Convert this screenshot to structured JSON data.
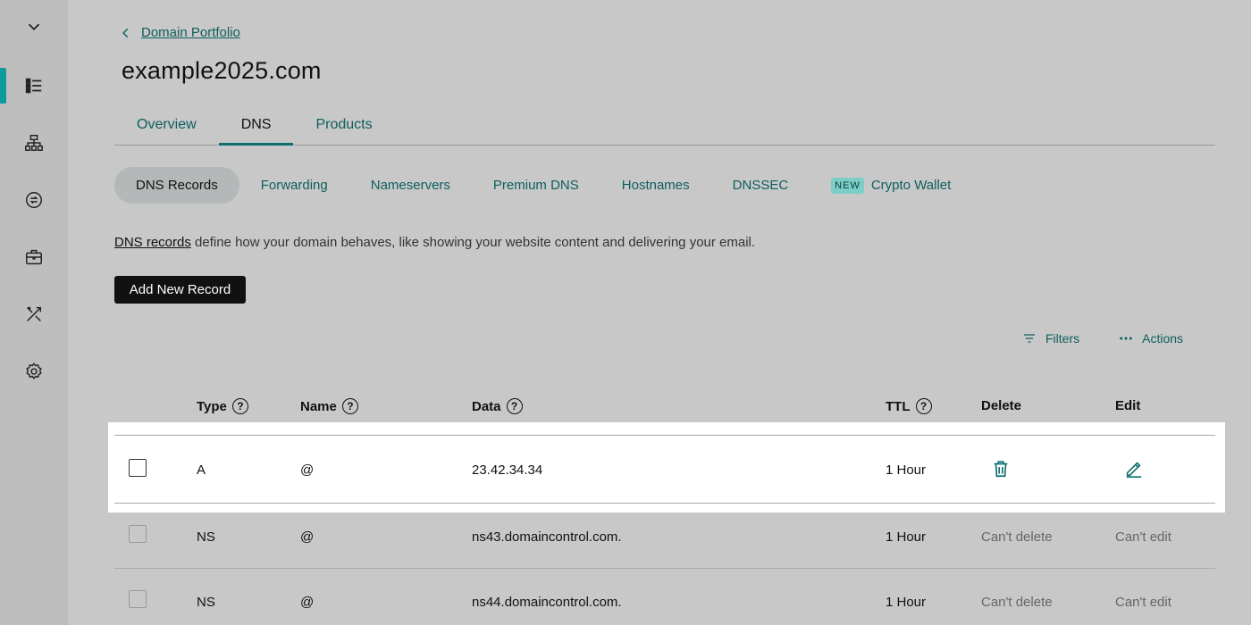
{
  "rail": {
    "items": [
      {
        "name": "collapse",
        "icon": "chevron-down-icon"
      },
      {
        "name": "list",
        "icon": "list-icon"
      },
      {
        "name": "sitemap",
        "icon": "sitemap-icon"
      },
      {
        "name": "transfer",
        "icon": "sync-icon"
      },
      {
        "name": "briefcase",
        "icon": "briefcase-icon"
      },
      {
        "name": "tools",
        "icon": "tools-icon"
      },
      {
        "name": "settings",
        "icon": "gear-icon"
      }
    ],
    "accent": "#0f9b9b"
  },
  "breadcrumb": {
    "back_label": "Domain Portfolio"
  },
  "page_title": "example2025.com",
  "tabs": [
    {
      "label": "Overview",
      "active": false
    },
    {
      "label": "DNS",
      "active": true
    },
    {
      "label": "Products",
      "active": false
    }
  ],
  "subnav": {
    "items": [
      {
        "label": "DNS Records",
        "active": true
      },
      {
        "label": "Forwarding"
      },
      {
        "label": "Nameservers"
      },
      {
        "label": "Premium DNS"
      },
      {
        "label": "Hostnames"
      },
      {
        "label": "DNSSEC"
      },
      {
        "label": "Crypto Wallet",
        "badge": "NEW"
      }
    ]
  },
  "description": {
    "link": "DNS records",
    "text": " define how your domain behaves, like showing your website content and delivering your email."
  },
  "add_button_label": "Add New Record",
  "toolbar": {
    "filters_label": "Filters",
    "actions_label": "Actions"
  },
  "table": {
    "headers": {
      "type": "Type",
      "name": "Name",
      "data": "Data",
      "ttl": "TTL",
      "delete": "Delete",
      "edit": "Edit"
    },
    "rows": [
      {
        "type": "A",
        "name": "@",
        "data": "23.42.34.34",
        "ttl": "1 Hour",
        "delete": "",
        "edit": "",
        "editable": true
      },
      {
        "type": "NS",
        "name": "@",
        "data": "ns43.domaincontrol.com.",
        "ttl": "1 Hour",
        "delete": "Can't delete",
        "edit": "Can't edit",
        "editable": false
      },
      {
        "type": "NS",
        "name": "@",
        "data": "ns44.domaincontrol.com.",
        "ttl": "1 Hour",
        "delete": "Can't delete",
        "edit": "Can't edit",
        "editable": false
      }
    ]
  }
}
